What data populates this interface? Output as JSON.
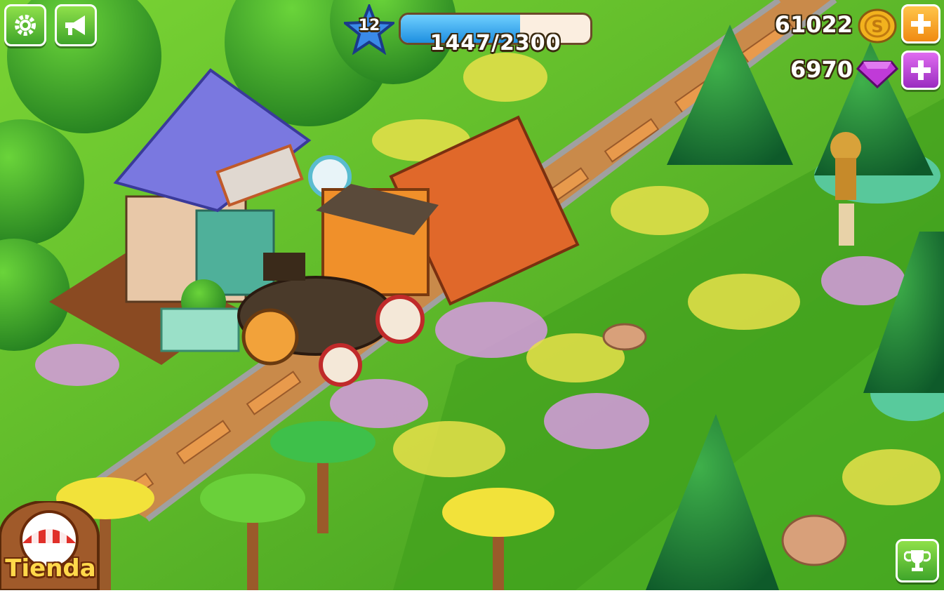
{
  "hud": {
    "level": "12",
    "xp_text": "1447/2300",
    "xp_fraction": 0.63,
    "coins": "61022",
    "gems": "6970"
  },
  "buttons": {
    "settings_icon": "gear-icon",
    "news_icon": "megaphone-icon",
    "add_coins_icon": "plus-icon",
    "add_gems_icon": "plus-icon",
    "achievements_icon": "trophy-icon",
    "shop_label": "Tienda"
  },
  "colors": {
    "grass": "#5fbf2a",
    "xp_fill": "#1e8fe0",
    "coin": "#f2b21e",
    "gem": "#c03ad8",
    "shop_label": "#ffd84a"
  }
}
